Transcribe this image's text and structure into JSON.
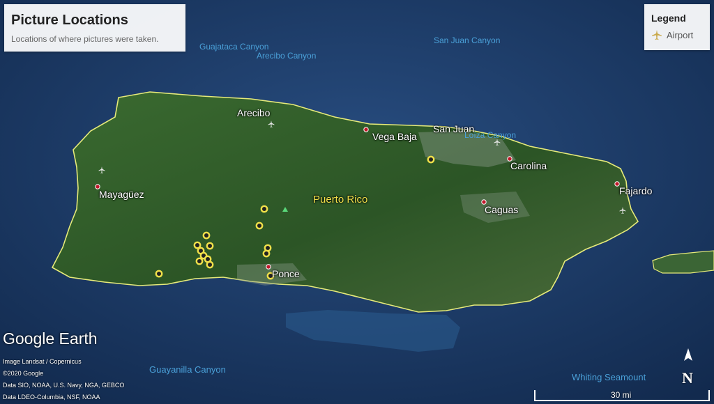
{
  "title_panel": {
    "title": "Picture Locations",
    "subtitle": "Locations of where pictures were taken."
  },
  "legend": {
    "title": "Legend",
    "items": [
      {
        "label": "Airport",
        "icon": "airplane-icon"
      }
    ]
  },
  "places": {
    "region": "Puerto Rico",
    "cities": [
      "Arecibo",
      "Vega Baja",
      "San Juan",
      "Mayagüez",
      "Carolina",
      "Caguas",
      "Fajardo",
      "Ponce"
    ],
    "features": [
      "Guajataca Canyon",
      "Arecibo Canyon",
      "San Juan Canyon",
      "Loíza Canyon",
      "Guayanilla Canyon",
      "Whiting Seamount"
    ]
  },
  "brand": "Google Earth",
  "credits": [
    "Image Landsat / Copernicus",
    "©2020 Google",
    "Data SIO, NOAA, U.S. Navy, NGA, GEBCO",
    "Data LDEO-Columbia, NSF, NOAA"
  ],
  "scale_bar": {
    "label": "30 mi"
  },
  "north_arrow": {
    "label": "N"
  },
  "colors": {
    "ocean": "#1b3a66",
    "land": "#2f5a2a",
    "coastline": "#e6ea7a",
    "marker_ring": "#f0e04a",
    "city_dot": "#c0182a"
  }
}
